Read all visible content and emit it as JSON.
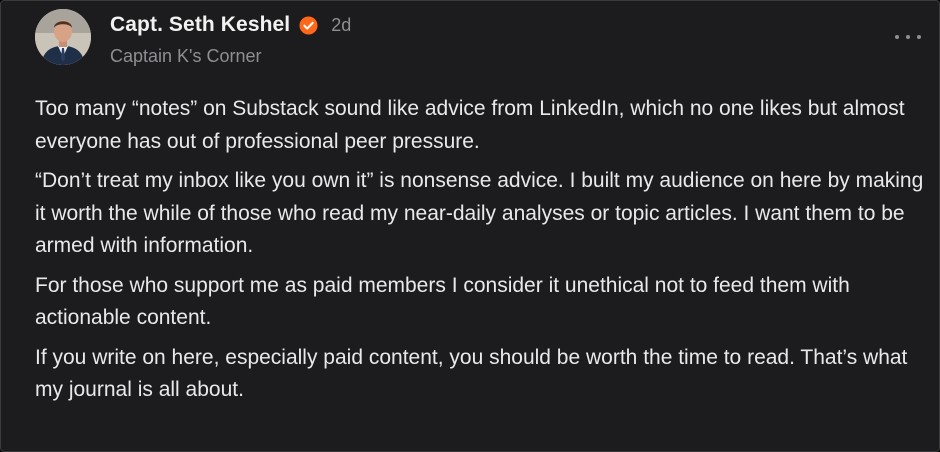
{
  "post": {
    "author": "Capt. Seth Keshel",
    "time": "2d",
    "publication": "Captain K's Corner",
    "verified_color": "#ff6719",
    "paragraphs": [
      "Too many “notes” on Substack sound like advice from LinkedIn, which no one likes but almost everyone has out of professional peer pressure.",
      "“Don’t treat my inbox like you own it” is nonsense advice. I built my audience on here by making it worth the while of those who read my near-daily analyses or topic articles. I want them to be armed with information.",
      "For those who support me as paid members I consider it unethical not to feed them with actionable content.",
      "If you write on here, especially paid content, you should be worth the time to read. That’s what my journal is all about."
    ]
  },
  "icons": {
    "verified": "verified-badge-icon",
    "more": "more-horizontal-icon"
  }
}
